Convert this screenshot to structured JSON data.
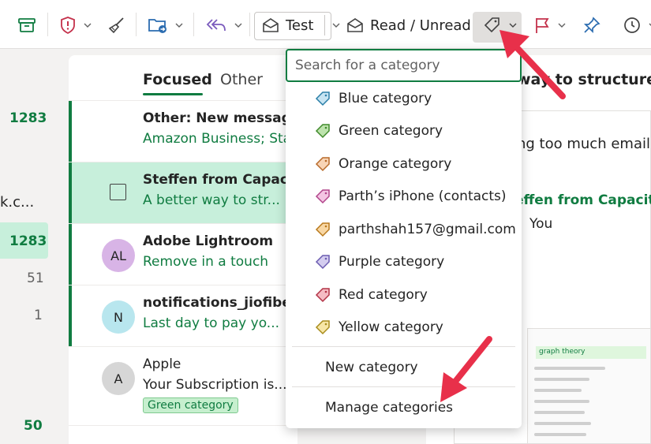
{
  "toolbar": {
    "test_label": "Test",
    "read_unread_label": "Read / Unread"
  },
  "folders": {
    "counts": [
      "1283",
      "1283",
      "51",
      "1",
      "50"
    ],
    "truncated_name": "k.c..."
  },
  "message_list": {
    "tabs": [
      "Focused",
      "Other"
    ],
    "messages": [
      {
        "sender": "Other: New messages",
        "subject": "Amazon Business; Star",
        "avatar": ""
      },
      {
        "sender": "Steffen from Capacities",
        "subject": "A better way to str...",
        "avatar": ""
      },
      {
        "sender": "Adobe Lightroom",
        "subject": "Remove in a touch",
        "avatar": "AL"
      },
      {
        "sender": "notifications_jiofiber@",
        "subject": "Last day to pay yo...",
        "avatar": "N"
      },
      {
        "sender": "Apple",
        "subject": "Your Subscription is...",
        "avatar": "A",
        "category": "Green category"
      }
    ]
  },
  "reading_pane": {
    "title": "way to structure c",
    "line1": "ng too much email?",
    "sender": "effen from Capacitie",
    "to": "You",
    "thumbnail_title": "graph theory"
  },
  "category_menu": {
    "search_placeholder": "Search for a category",
    "categories": [
      {
        "name": "Blue category",
        "color": "#5fb3d9"
      },
      {
        "name": "Green category",
        "color": "#6cc24a"
      },
      {
        "name": "Orange category",
        "color": "#f0a05a"
      },
      {
        "name": "Parth’s iPhone (contacts)",
        "color": "#e77fc2"
      },
      {
        "name": "parthshah157@gmail.com",
        "color": "#f2b04a"
      },
      {
        "name": "Purple category",
        "color": "#a99be0"
      },
      {
        "name": "Red category",
        "color": "#e8697a"
      },
      {
        "name": "Yellow category",
        "color": "#f1d15c"
      }
    ],
    "new_category": "New category",
    "manage_categories": "Manage categories"
  },
  "colors": {
    "accent": "#107c41",
    "selected_row": "#c7efdb",
    "annotation_arrow": "#e8304a"
  }
}
